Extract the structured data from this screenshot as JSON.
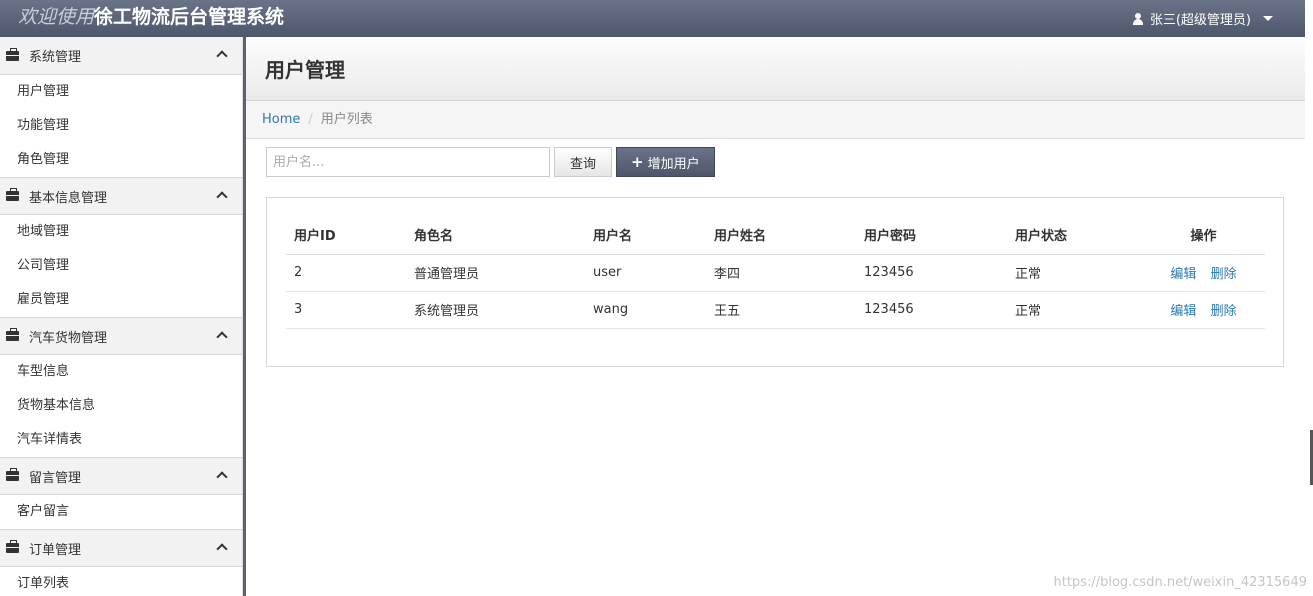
{
  "header": {
    "welcome": "欢迎使用",
    "system_name": "徐工物流后台管理系统",
    "user": "张三(超级管理员)"
  },
  "sidebar": {
    "groups": [
      {
        "title": "系统管理",
        "items": [
          "用户管理",
          "功能管理",
          "角色管理"
        ]
      },
      {
        "title": "基本信息管理",
        "items": [
          "地域管理",
          "公司管理",
          "雇员管理"
        ]
      },
      {
        "title": "汽车货物管理",
        "items": [
          "车型信息",
          "货物基本信息",
          "汽车详情表"
        ]
      },
      {
        "title": "留言管理",
        "items": [
          "客户留言"
        ]
      },
      {
        "title": "订单管理",
        "items": [
          "订单列表"
        ]
      }
    ]
  },
  "main": {
    "title": "用户管理",
    "breadcrumb": {
      "home": "Home",
      "current": "用户列表"
    },
    "search": {
      "placeholder": "用户名...",
      "value": ""
    },
    "query_label": "查询",
    "add_label": "增加用户",
    "table": {
      "columns": [
        "用户ID",
        "角色名",
        "用户名",
        "用户姓名",
        "用户密码",
        "用户状态",
        "操作"
      ],
      "rows": [
        {
          "id": "2",
          "role": "普通管理员",
          "username": "user",
          "name": "李四",
          "password": "123456",
          "status": "正常"
        },
        {
          "id": "3",
          "role": "系统管理员",
          "username": "wang",
          "name": "王五",
          "password": "123456",
          "status": "正常"
        }
      ],
      "edit_label": "编辑",
      "delete_label": "删除"
    }
  },
  "watermark": "https://blog.csdn.net/weixin_42315649"
}
